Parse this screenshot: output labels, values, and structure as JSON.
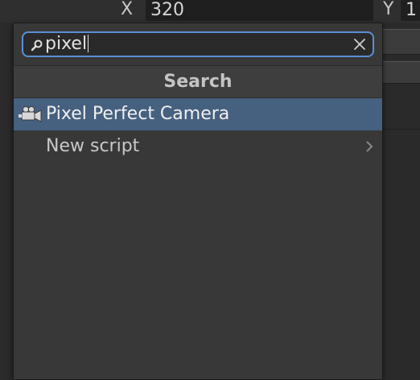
{
  "background": {
    "x_label": "X",
    "x_value": "320",
    "y_label": "Y",
    "y_value": "1"
  },
  "popup": {
    "search": {
      "value": "pixel",
      "icon": "search-icon",
      "clear_icon": "close-icon"
    },
    "header": "Search",
    "items": [
      {
        "label": "Pixel Perfect Camera",
        "icon": "camera-icon",
        "selected": true
      },
      {
        "label": "New script",
        "icon": "chevron-right-icon",
        "selected": false
      }
    ]
  },
  "colors": {
    "selection": "#46607f",
    "focus_border": "#5b8fd6",
    "panel": "#383838"
  }
}
